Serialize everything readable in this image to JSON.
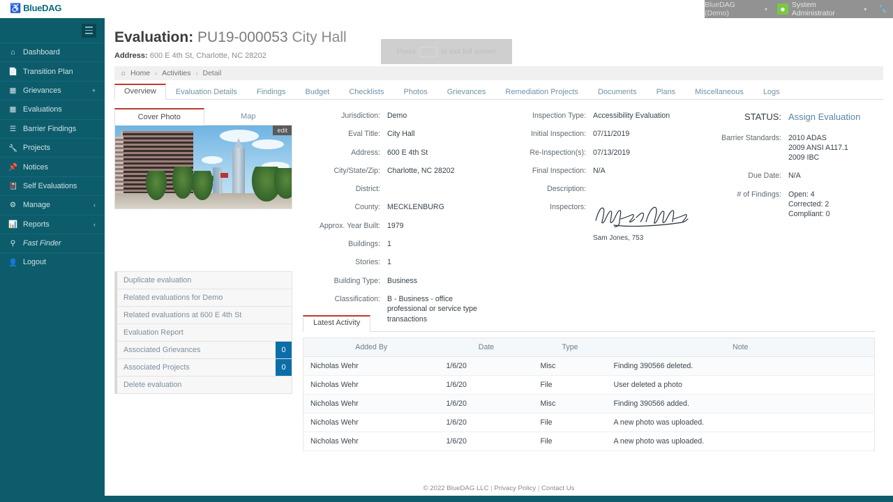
{
  "brand": {
    "logo_text": "BlueDAG",
    "logo_icon": "wheelchair-accessible-icon",
    "primary_color": "#0d5c6b",
    "accent_color": "#c0392b",
    "badge_color": "#0b6ea8"
  },
  "topbar": {
    "tenant": "BlueDAG (Demo)",
    "user": "System Administrator",
    "avatar_icon": "user-avatar-icon",
    "wrench_icon": "wrench-icon",
    "caret_icon": "chevron-down-icon"
  },
  "sidebar": {
    "toggle_icon": "hamburger-menu-icon",
    "items": [
      {
        "label": "Dashboard",
        "icon": "home-icon",
        "chevron": ""
      },
      {
        "label": "Transition Plan",
        "icon": "file-icon",
        "chevron": ""
      },
      {
        "label": "Grievances",
        "icon": "window-icon",
        "chevron": "+"
      },
      {
        "label": "Evaluations",
        "icon": "window-icon",
        "chevron": ""
      },
      {
        "label": "Barrier Findings",
        "icon": "list-icon",
        "chevron": ""
      },
      {
        "label": "Projects",
        "icon": "wrench-icon",
        "chevron": ""
      },
      {
        "label": "Notices",
        "icon": "pin-icon",
        "chevron": ""
      },
      {
        "label": "Self Evaluations",
        "icon": "book-icon",
        "chevron": ""
      },
      {
        "label": "Manage",
        "icon": "gear-icon",
        "chevron": "‹"
      },
      {
        "label": "Reports",
        "icon": "chart-icon",
        "chevron": "‹"
      },
      {
        "label": "Fast Finder",
        "icon": "search-icon",
        "chevron": "",
        "italic": true
      },
      {
        "label": "Logout",
        "icon": "user-icon",
        "chevron": ""
      }
    ]
  },
  "header": {
    "title_label": "Evaluation:",
    "eval_id": "PU19-000053",
    "eval_name": "City Hall",
    "address_label": "Address:",
    "address_value": "600 E 4th St, Charlotte, NC 28202"
  },
  "fullscreen_hint": {
    "prefix": "Press",
    "key": "F11",
    "suffix": "to exit full screen"
  },
  "breadcrumb": {
    "home_icon": "home-icon",
    "items": [
      "Home",
      "Activities",
      "Detail"
    ],
    "separator": "›"
  },
  "tabs": [
    {
      "label": "Overview",
      "active": true
    },
    {
      "label": "Evaluation Details",
      "active": false
    },
    {
      "label": "Findings",
      "active": false
    },
    {
      "label": "Budget",
      "active": false
    },
    {
      "label": "Checklists",
      "active": false
    },
    {
      "label": "Photos",
      "active": false
    },
    {
      "label": "Grievances",
      "active": false
    },
    {
      "label": "Remediation Projects",
      "active": false
    },
    {
      "label": "Documents",
      "active": false
    },
    {
      "label": "Plans",
      "active": false
    },
    {
      "label": "Miscellaneous",
      "active": false
    },
    {
      "label": "Logs",
      "active": false
    }
  ],
  "photo_panel": {
    "tabs": [
      {
        "label": "Cover Photo",
        "active": true
      },
      {
        "label": "Map",
        "active": false
      }
    ],
    "edit_label": "edit",
    "image_description": "City Hall building exterior with trees and Charlotte skyline"
  },
  "action_list": [
    {
      "label": "Duplicate evaluation",
      "badge": ""
    },
    {
      "label": "Related evaluations for Demo",
      "badge": ""
    },
    {
      "label": "Related evaluations at 600 E 4th St",
      "badge": ""
    },
    {
      "label": "Evaluation Report",
      "badge": ""
    },
    {
      "label": "Associated Grievances",
      "badge": "0"
    },
    {
      "label": "Associated Projects",
      "badge": "0"
    },
    {
      "label": "Delete evaluation",
      "badge": ""
    }
  ],
  "details_col_a": [
    {
      "label": "Jurisdiction:",
      "value": "Demo"
    },
    {
      "label": "Eval Title:",
      "value": "City Hall"
    },
    {
      "label": "Address:",
      "value": "600 E 4th St"
    },
    {
      "label": "City/State/Zip:",
      "value": "Charlotte, NC 28202"
    },
    {
      "label": "District:",
      "value": ""
    },
    {
      "label": "County:",
      "value": "MECKLENBURG"
    },
    {
      "label": "Approx. Year Built:",
      "value": "1979"
    },
    {
      "label": "Buildings:",
      "value": "1"
    },
    {
      "label": "Stories:",
      "value": "1"
    },
    {
      "label": "Building Type:",
      "value": "Business"
    },
    {
      "label": "Classification:",
      "value": "B - Business - office professional or service type transactions"
    }
  ],
  "details_col_b": [
    {
      "label": "Inspection Type:",
      "value": "Accessibility Evaluation"
    },
    {
      "label": "Initial Inspection:",
      "value": "07/11/2019"
    },
    {
      "label": "Re-Inspection(s):",
      "value": "07/13/2019"
    },
    {
      "label": "Final Inspection:",
      "value": "N/A"
    },
    {
      "label": "Description:",
      "value": ""
    }
  ],
  "inspectors": {
    "label": "Inspectors:",
    "signature_icon": "handwritten-signature-icon",
    "name": "Sam Jones, 753"
  },
  "details_col_c": {
    "status_label": "STATUS:",
    "status_value": "Assign Evaluation",
    "barrier_standards_label": "Barrier Standards:",
    "barrier_standards": [
      "2010 ADAS",
      "2009 ANSI A117.1",
      "2009 IBC"
    ],
    "due_date_label": "Due Date:",
    "due_date_value": "N/A",
    "findings_label": "# of Findings:",
    "findings": [
      "Open: 4",
      "Corrected: 2",
      "Compliant: 0"
    ]
  },
  "latest_activity": {
    "tab_label": "Latest Activity",
    "columns": [
      "Added By",
      "Date",
      "Type",
      "Note"
    ],
    "rows": [
      {
        "added_by": "Nicholas Wehr",
        "date": "1/6/20",
        "type": "Misc",
        "note": "Finding 390566 deleted."
      },
      {
        "added_by": "Nicholas Wehr",
        "date": "1/6/20",
        "type": "File",
        "note": "User deleted a photo"
      },
      {
        "added_by": "Nicholas Wehr",
        "date": "1/6/20",
        "type": "Misc",
        "note": "Finding 390566 added."
      },
      {
        "added_by": "Nicholas Wehr",
        "date": "1/6/20",
        "type": "File",
        "note": "A new photo was uploaded."
      },
      {
        "added_by": "Nicholas Wehr",
        "date": "1/6/20",
        "type": "File",
        "note": "A new photo was uploaded."
      }
    ]
  },
  "footer": {
    "copyright": "© 2022 BlueDAG LLC",
    "privacy": "Privacy Policy",
    "contact": "Contact Us",
    "separator": "|"
  }
}
